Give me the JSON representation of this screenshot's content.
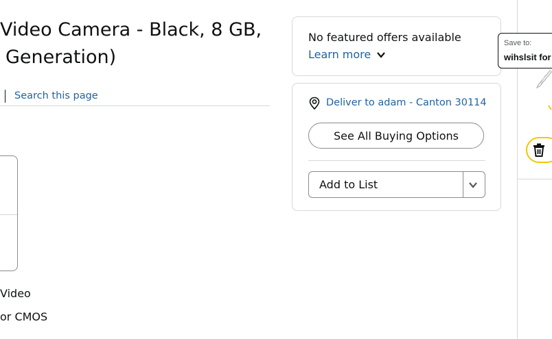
{
  "product": {
    "title_line1": "Video Camera - Black, 8 GB,",
    "title_line2": "Generation)"
  },
  "nav": {
    "search_link": "Search this page"
  },
  "specs": {
    "line1": "Video",
    "line2": "or CMOS"
  },
  "offers": {
    "no_offers": "No featured offers available",
    "learn_more": "Learn more"
  },
  "buy": {
    "deliver_to": "Deliver to adam - Canton 30114",
    "see_all": "See All Buying Options",
    "add_to_list": "Add to List"
  },
  "sidebar": {
    "save_to": "Save to:",
    "list_name": "wihslsit for"
  },
  "colors": {
    "link": "#2162a1",
    "border": "#d5d9d9",
    "accent_yellow": "#f0c800"
  }
}
